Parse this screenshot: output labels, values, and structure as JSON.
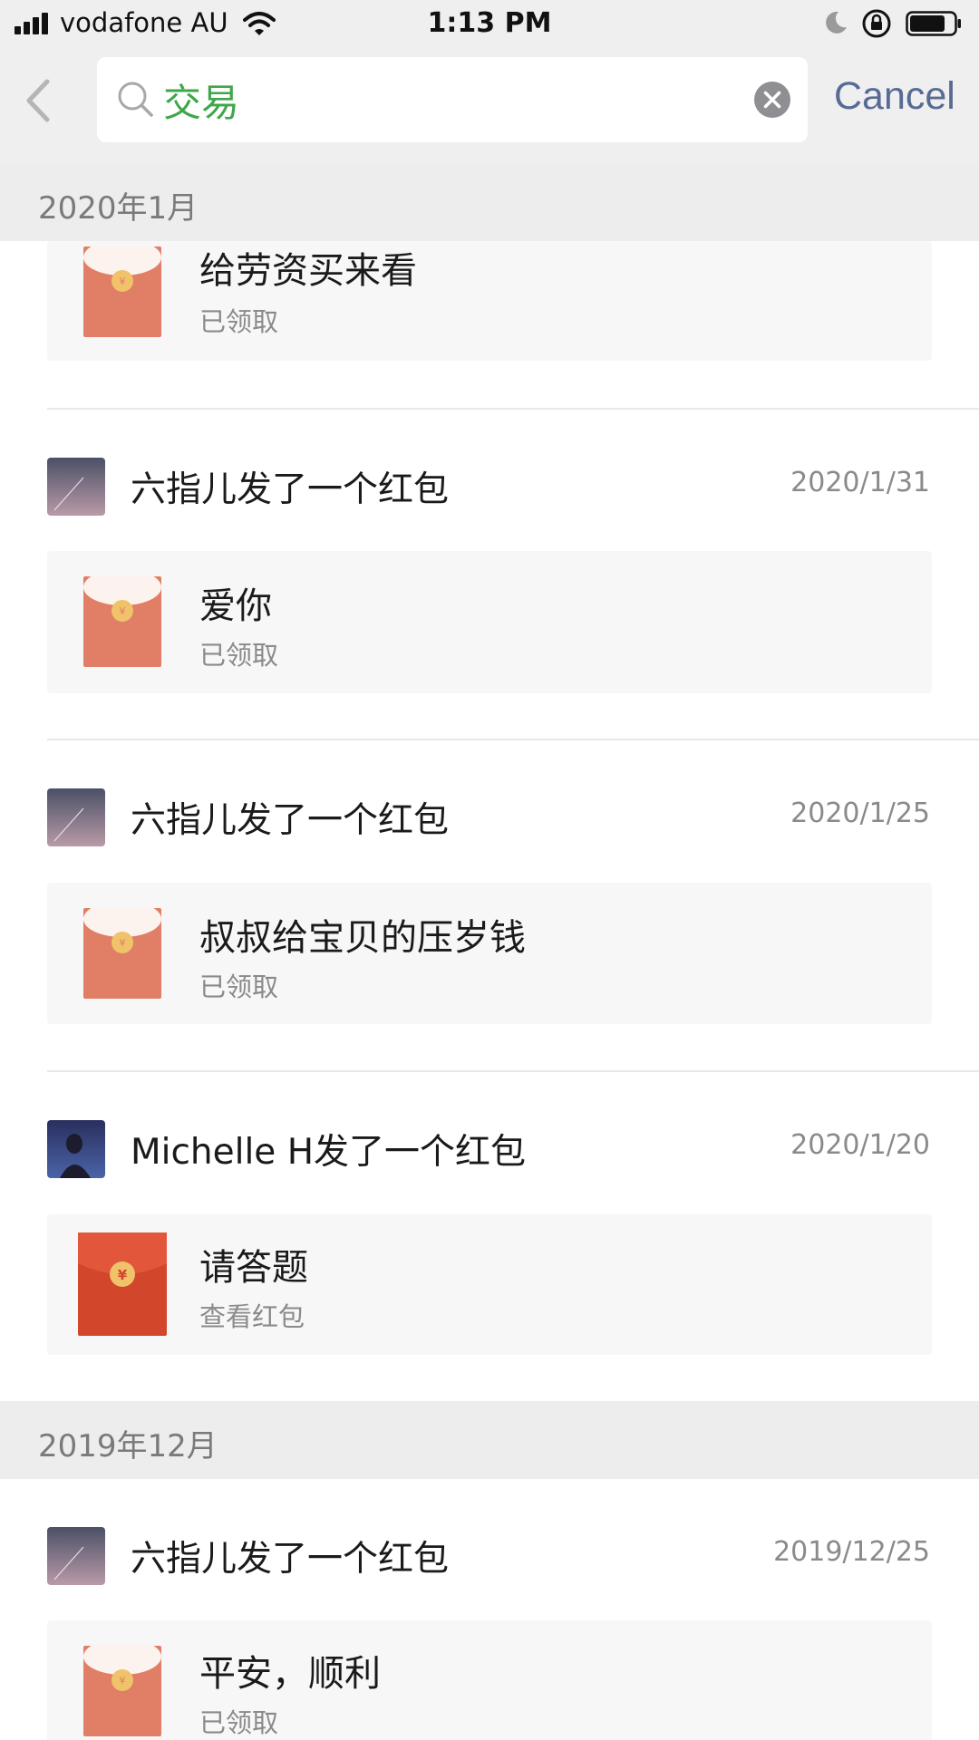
{
  "status_bar": {
    "carrier": "vodafone AU",
    "time": "1:13 PM"
  },
  "search": {
    "query": "交易",
    "cancel_label": "Cancel"
  },
  "sections": [
    {
      "label": "2020年1月"
    },
    {
      "label": "2019年12月"
    }
  ],
  "items": [
    {
      "sender": "",
      "date": "",
      "message": "给劳资买来看",
      "status": "已领取",
      "envelope": "opened"
    },
    {
      "sender": "六指儿发了一个红包",
      "date": "2020/1/31",
      "message": "爱你",
      "status": "已领取",
      "envelope": "opened"
    },
    {
      "sender": "六指儿发了一个红包",
      "date": "2020/1/25",
      "message": "叔叔给宝贝的压岁钱",
      "status": "已领取",
      "envelope": "opened"
    },
    {
      "sender": "Michelle H发了一个红包",
      "date": "2020/1/20",
      "message": "请答题",
      "status": "查看红包",
      "envelope": "unopened"
    },
    {
      "sender": "六指儿发了一个红包",
      "date": "2019/12/25",
      "message": "平安，顺利",
      "status": "已领取",
      "envelope": "opened"
    }
  ],
  "colors": {
    "accent_green": "#3fa64a",
    "link_blue": "#576b95",
    "envelope_opened": "#e07e66",
    "envelope_unopened": "#d2462c",
    "coin": "#f0c26a"
  },
  "icons": {
    "back": "chevron-left-icon",
    "search": "search-icon",
    "clear": "clear-icon",
    "envelope": "red-packet-icon"
  }
}
